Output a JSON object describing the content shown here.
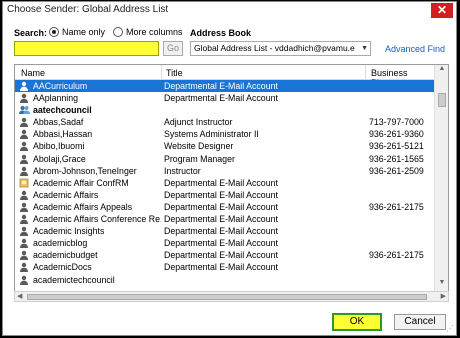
{
  "window": {
    "title": "Choose Sender: Global Address List",
    "close_label": "✕"
  },
  "search": {
    "label": "Search:",
    "value": "",
    "go_label": "Go"
  },
  "radios": {
    "name_only": "Name only",
    "more_columns": "More columns"
  },
  "address_book": {
    "label": "Address Book",
    "value": "Global Address List - vddadhich@pvamu.e",
    "advanced_find": "Advanced Find"
  },
  "columns": {
    "name": "Name",
    "title": "Title",
    "phone": "Business Phone"
  },
  "rows": [
    {
      "name": "AACurriculum",
      "title": "Departmental E-Mail Account",
      "phone": "",
      "icon": "person-icon",
      "selected": true
    },
    {
      "name": "AAplanning",
      "title": "Departmental E-Mail Account",
      "phone": "",
      "icon": "person-icon"
    },
    {
      "name": "aatechcouncil",
      "title": "",
      "phone": "",
      "icon": "group-icon",
      "group": true
    },
    {
      "name": "Abbas,Sadaf",
      "title": "Adjunct Instructor",
      "phone": "713-797-7000",
      "icon": "person-icon"
    },
    {
      "name": "Abbasi,Hassan",
      "title": "Systems Administrator II",
      "phone": "936-261-9360",
      "icon": "person-icon"
    },
    {
      "name": "Abibo,Ibuomi",
      "title": "Website Designer",
      "phone": "936-261-5121",
      "icon": "person-icon"
    },
    {
      "name": "Abolaji,Grace",
      "title": "Program Manager",
      "phone": "936-261-1565",
      "icon": "person-icon"
    },
    {
      "name": "Abrom-Johnson,TeneInger",
      "title": "Instructor",
      "phone": "936-261-2509",
      "icon": "person-icon"
    },
    {
      "name": "Academic Affair ConfRM",
      "title": "Departmental E-Mail Account",
      "phone": "",
      "icon": "room-icon"
    },
    {
      "name": "Academic Affairs",
      "title": "Departmental E-Mail Account",
      "phone": "",
      "icon": "person-icon"
    },
    {
      "name": "Academic Affairs Appeals",
      "title": "Departmental E-Mail Account",
      "phone": "936-261-2175",
      "icon": "person-icon"
    },
    {
      "name": "Academic Affairs Conference Re...",
      "title": "Departmental E-Mail Account",
      "phone": "",
      "icon": "person-icon"
    },
    {
      "name": "Academic Insights",
      "title": "Departmental E-Mail Account",
      "phone": "",
      "icon": "person-icon"
    },
    {
      "name": "academicblog",
      "title": "Departmental E-Mail Account",
      "phone": "",
      "icon": "person-icon"
    },
    {
      "name": "academicbudget",
      "title": "Departmental E-Mail Account",
      "phone": "936-261-2175",
      "icon": "person-icon"
    },
    {
      "name": "AcademicDocs",
      "title": "Departmental E-Mail Account",
      "phone": "",
      "icon": "person-icon"
    },
    {
      "name": "academictechcouncil",
      "title": "",
      "phone": "",
      "icon": "person-icon"
    }
  ],
  "buttons": {
    "ok": "OK",
    "cancel": "Cancel"
  },
  "colors": {
    "selection": "#1874d6",
    "highlight": "#ffff33",
    "ok_border": "#2a9a2a",
    "link": "#1a5fb4"
  }
}
